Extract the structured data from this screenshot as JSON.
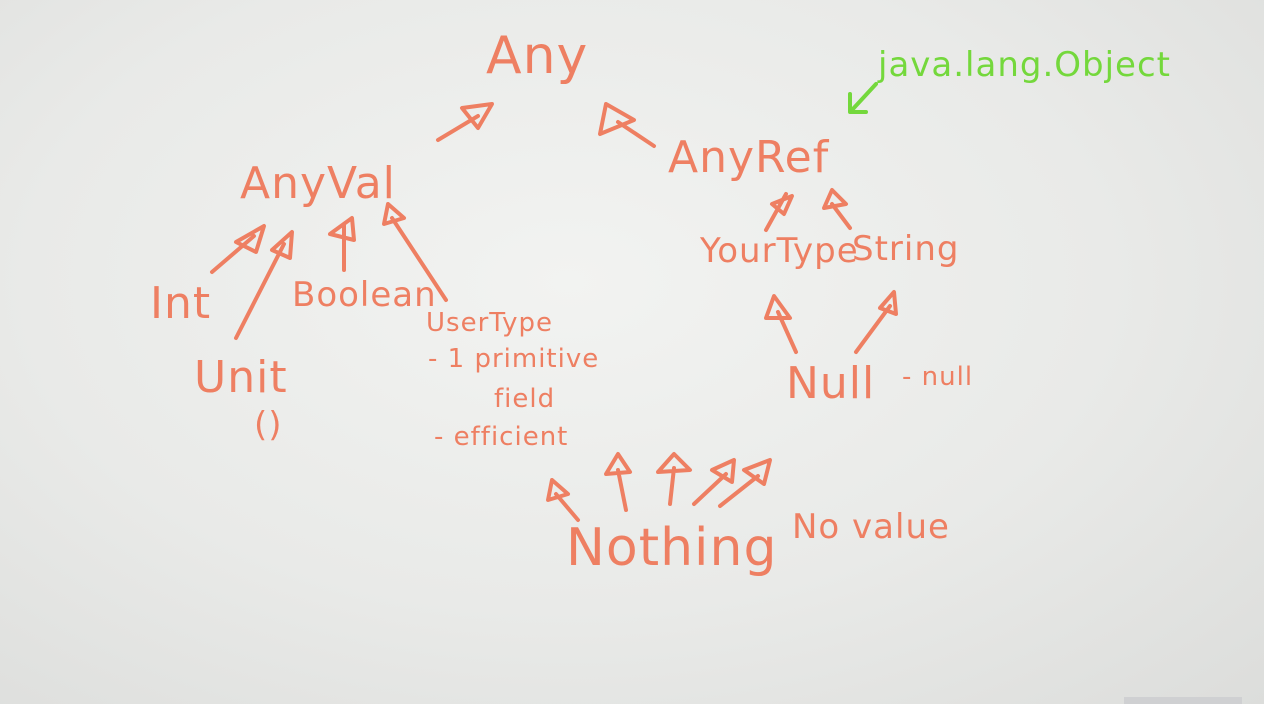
{
  "colors": {
    "marker": "#ee7f62",
    "accent": "#74d83c",
    "board": "#ecedeb"
  },
  "nodes": {
    "any": "Any",
    "anyref": "AnyRef",
    "anyval": "AnyVal",
    "java_object": "java.lang.Object",
    "int": "Int",
    "boolean": "Boolean",
    "unit": "Unit",
    "unit_value": "()",
    "usertype": "UserType",
    "usertype_note1": "- 1 primitive",
    "usertype_note2": "field",
    "usertype_note3": "- efficient",
    "yourtype": "YourType",
    "string": "String",
    "null": "Null",
    "null_value": "- null",
    "nothing": "Nothing",
    "novalue": "No value"
  }
}
